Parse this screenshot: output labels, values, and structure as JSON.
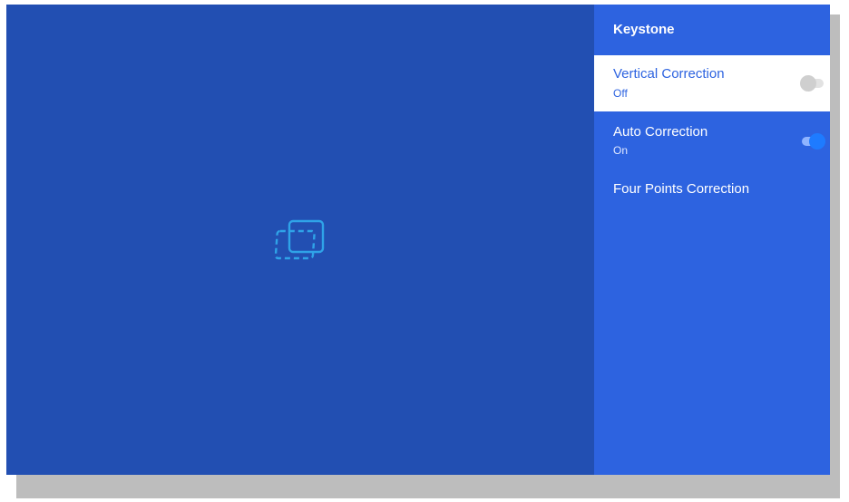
{
  "panel": {
    "title": "Keystone"
  },
  "menu": {
    "items": [
      {
        "label": "Vertical Correction",
        "value": "Off",
        "toggle": "off",
        "selected": true
      },
      {
        "label": "Auto Correction",
        "value": "On",
        "toggle": "on",
        "selected": false
      },
      {
        "label": "Four Points Correction",
        "selected": false
      }
    ]
  },
  "icons": {
    "preview": "keystone-correction-icon",
    "toggle_off": "toggle-off",
    "toggle_on": "toggle-on"
  },
  "colors": {
    "preview_bg": "#224fb2",
    "panel_bg": "#2d63e0",
    "selected_bg": "#ffffff",
    "selected_text": "#2d63e0",
    "toggle_on_thumb": "#1e7bff",
    "toggle_on_track": "#8fb4ff",
    "toggle_off_thumb": "#cfcfcf",
    "toggle_off_track": "#e2e2e2"
  }
}
